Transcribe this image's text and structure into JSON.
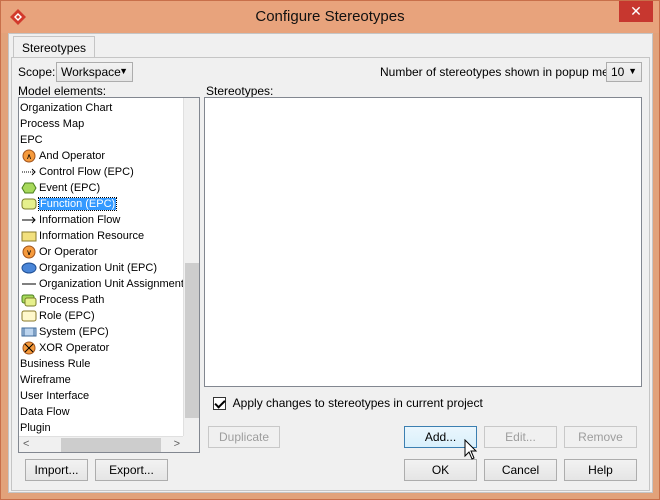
{
  "window": {
    "title": "Configure Stereotypes",
    "close_label": "✕"
  },
  "tabs": [
    {
      "label": "Stereotypes"
    }
  ],
  "scope": {
    "label": "Scope:",
    "value": "Workspace"
  },
  "popup_count": {
    "label": "Number of stereotypes shown in popup menu:",
    "value": "10"
  },
  "model_elements": {
    "label": "Model elements:",
    "items": [
      {
        "label": "Organization Chart",
        "icon": "none",
        "level": 0
      },
      {
        "label": "Process Map",
        "icon": "none",
        "level": 0
      },
      {
        "label": "EPC",
        "icon": "none",
        "level": 0
      },
      {
        "label": "And Operator",
        "icon": "and-operator-icon",
        "level": 1
      },
      {
        "label": "Control Flow (EPC)",
        "icon": "control-flow-icon",
        "level": 1
      },
      {
        "label": "Event (EPC)",
        "icon": "event-icon",
        "level": 1
      },
      {
        "label": "Function (EPC)",
        "icon": "function-icon",
        "level": 1,
        "selected": true
      },
      {
        "label": "Information Flow",
        "icon": "information-flow-icon",
        "level": 1
      },
      {
        "label": "Information Resource",
        "icon": "information-resource-icon",
        "level": 1
      },
      {
        "label": "Or Operator",
        "icon": "or-operator-icon",
        "level": 1
      },
      {
        "label": "Organization Unit (EPC)",
        "icon": "organization-unit-icon",
        "level": 1
      },
      {
        "label": "Organization Unit Assignment",
        "icon": "organization-unit-assignment-icon",
        "level": 1
      },
      {
        "label": "Process Path",
        "icon": "process-path-icon",
        "level": 1
      },
      {
        "label": "Role (EPC)",
        "icon": "role-icon",
        "level": 1
      },
      {
        "label": "System (EPC)",
        "icon": "system-icon",
        "level": 1
      },
      {
        "label": "XOR Operator",
        "icon": "xor-operator-icon",
        "level": 1
      },
      {
        "label": "Business Rule",
        "icon": "none",
        "level": 0
      },
      {
        "label": "Wireframe",
        "icon": "none",
        "level": 0
      },
      {
        "label": "User Interface",
        "icon": "none",
        "level": 0
      },
      {
        "label": "Data Flow",
        "icon": "none",
        "level": 0
      },
      {
        "label": "Plugin",
        "icon": "none",
        "level": 0
      }
    ]
  },
  "stereotypes": {
    "label": "Stereotypes:",
    "items": []
  },
  "apply_checkbox": {
    "label": "Apply changes to stereotypes in current project",
    "checked": true
  },
  "buttons": {
    "duplicate": "Duplicate",
    "add": "Add...",
    "edit": "Edit...",
    "remove": "Remove",
    "import": "Import...",
    "export": "Export...",
    "ok": "OK",
    "cancel": "Cancel",
    "help": "Help"
  }
}
